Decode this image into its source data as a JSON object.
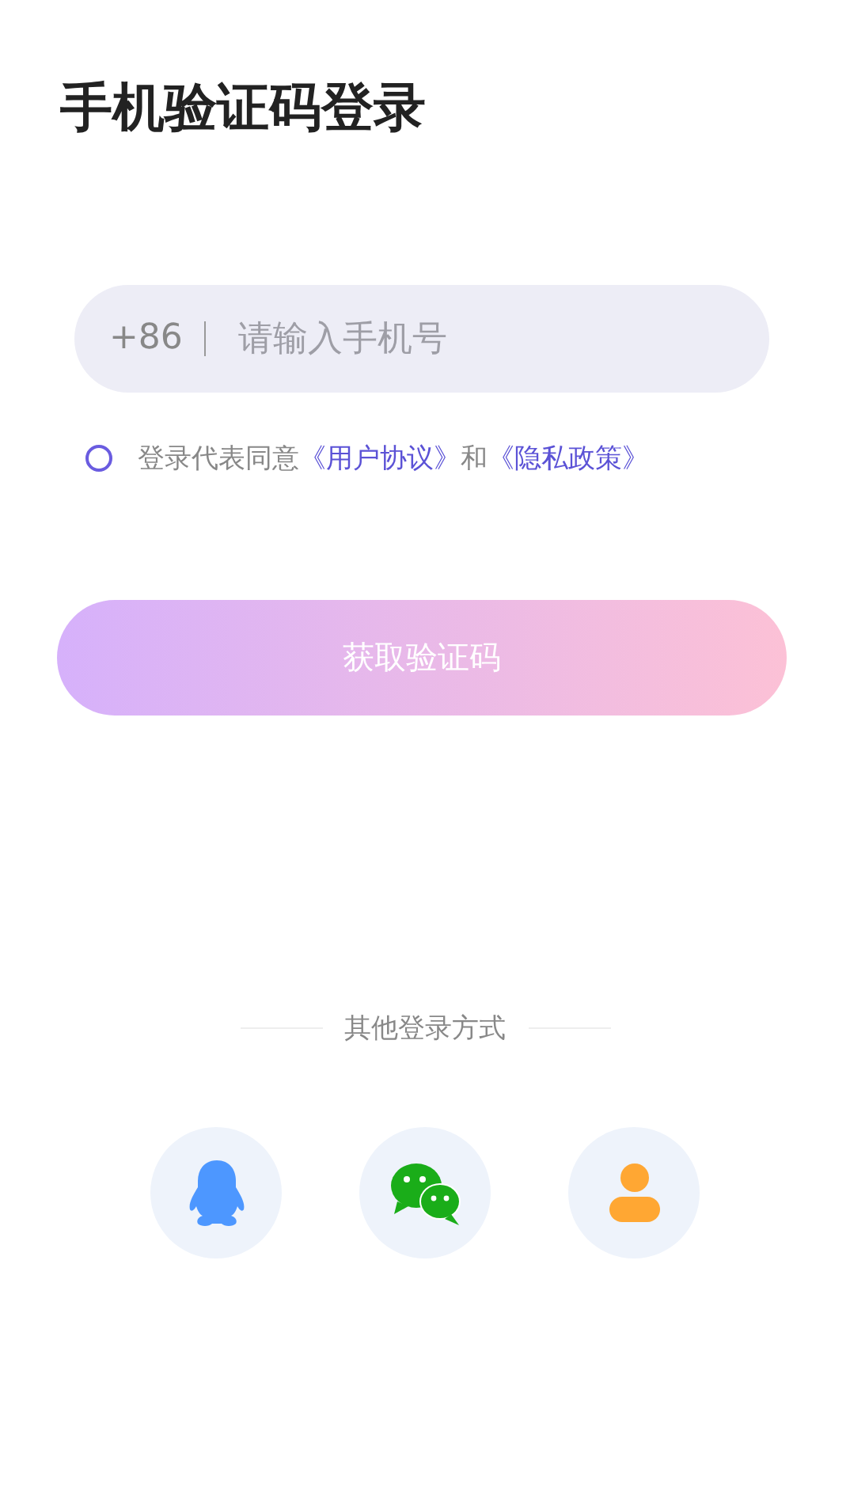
{
  "title": "手机验证码登录",
  "phone_field": {
    "country_code": "+86",
    "placeholder": "请输入手机号"
  },
  "agreement": {
    "checked": false,
    "prefix": "登录代表同意",
    "links": [
      "《用户协议》",
      "《隐私政策》"
    ],
    "joiner": "和"
  },
  "submit_button": {
    "label": "获取验证码"
  },
  "other_login": {
    "label": "其他登录方式",
    "options": [
      {
        "kind": "qq"
      },
      {
        "kind": "wechat"
      },
      {
        "kind": "guest"
      }
    ]
  }
}
